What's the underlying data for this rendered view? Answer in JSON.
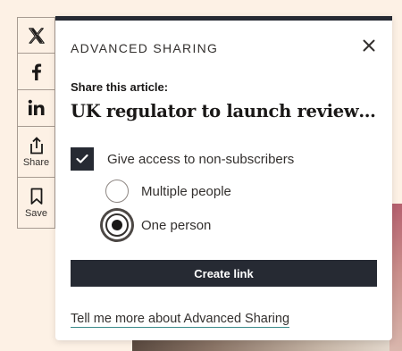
{
  "share_rail": {
    "items": [
      {
        "icon": "x-logo-icon",
        "label": ""
      },
      {
        "icon": "facebook-icon",
        "label": ""
      },
      {
        "icon": "linkedin-icon",
        "label": ""
      },
      {
        "icon": "share-icon",
        "label": "Share"
      },
      {
        "icon": "bookmark-icon",
        "label": "Save"
      }
    ]
  },
  "dialog": {
    "title": "ADVANCED SHARING",
    "share_label": "Share this article:",
    "article_title": "UK regulator to launch review of cloud computing market",
    "checkbox": {
      "label": "Give access to non-subscribers",
      "checked": true
    },
    "radios": [
      {
        "label": "Multiple people",
        "checked": false
      },
      {
        "label": "One person",
        "checked": true
      }
    ],
    "create_button": "Create link",
    "more_link": "Tell me more about Advanced Sharing"
  },
  "colors": {
    "page_background": "#fdf1e5",
    "primary_dark": "#262a33",
    "link_underline": "#3a8a8a"
  }
}
